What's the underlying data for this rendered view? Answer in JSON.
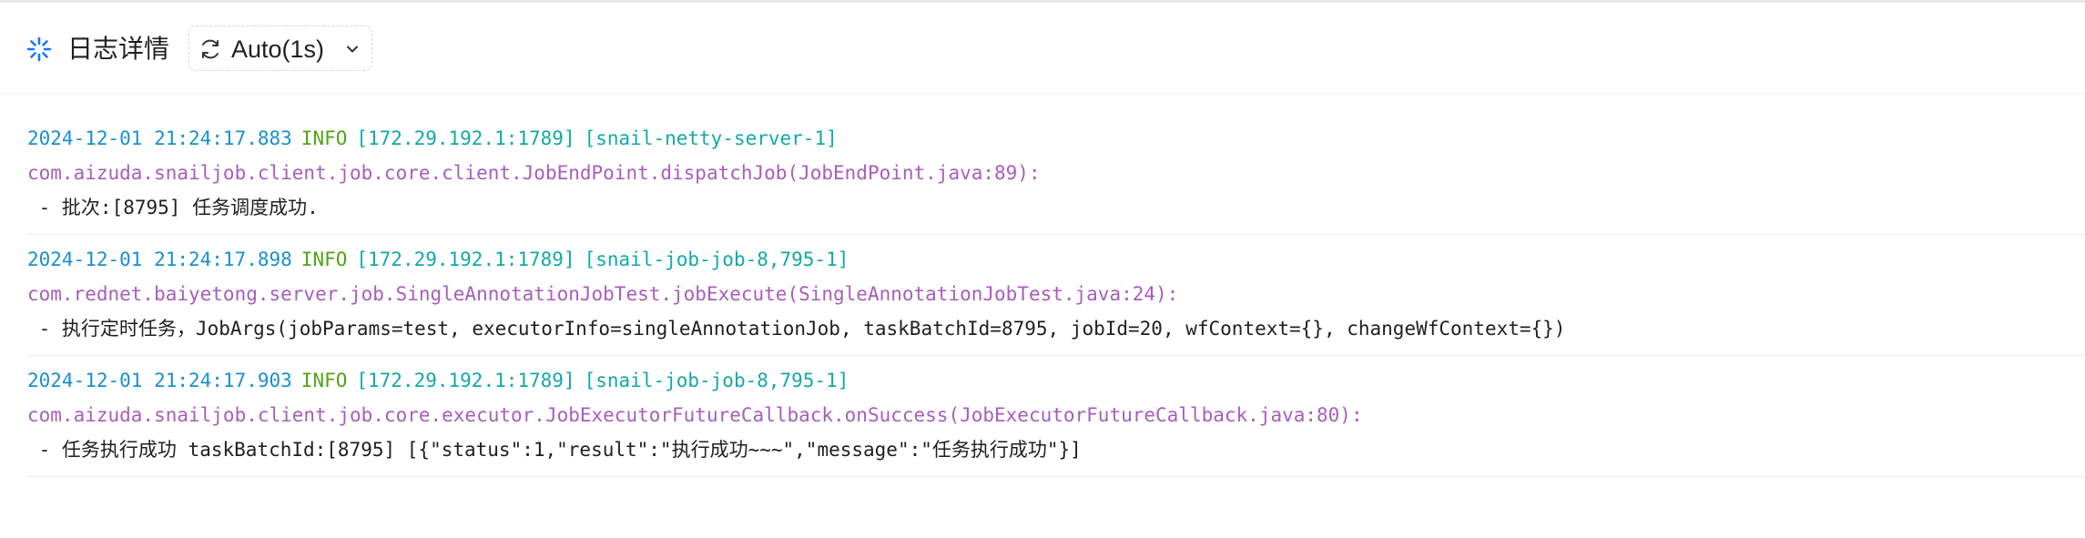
{
  "header": {
    "title": "日志详情",
    "refresh_label": "Auto(1s)",
    "icons": {
      "loading": "loading-spinner-icon",
      "refresh": "refresh-icon",
      "dropdown": "chevron-down-icon"
    }
  },
  "colors": {
    "timestamp": "#1890cf",
    "level": "#52a317",
    "host": "#13a8a8",
    "location": "#a85dbc",
    "message": "#1f1f1f",
    "spinner": "#1677ff"
  },
  "logs": [
    {
      "timestamp": "2024-12-01 21:24:17.883",
      "level": "INFO",
      "host": "[172.29.192.1:1789]",
      "thread": "[snail-netty-server-1]",
      "location": "com.aizuda.snailjob.client.job.core.client.JobEndPoint.dispatchJob(JobEndPoint.java:89):",
      "message": " - 批次:[8795] 任务调度成功."
    },
    {
      "timestamp": "2024-12-01 21:24:17.898",
      "level": "INFO",
      "host": "[172.29.192.1:1789]",
      "thread": "[snail-job-job-8,795-1]",
      "location": "com.rednet.baiyetong.server.job.SingleAnnotationJobTest.jobExecute(SingleAnnotationJobTest.java:24):",
      "message": " - 执行定时任务，JobArgs(jobParams=test, executorInfo=singleAnnotationJob, taskBatchId=8795, jobId=20, wfContext={}, changeWfContext={})"
    },
    {
      "timestamp": "2024-12-01 21:24:17.903",
      "level": "INFO",
      "host": "[172.29.192.1:1789]",
      "thread": "[snail-job-job-8,795-1]",
      "location": "com.aizuda.snailjob.client.job.core.executor.JobExecutorFutureCallback.onSuccess(JobExecutorFutureCallback.java:80):",
      "message": " - 任务执行成功 taskBatchId:[8795] [{\"status\":1,\"result\":\"执行成功~~~\",\"message\":\"任务执行成功\"}]"
    }
  ]
}
